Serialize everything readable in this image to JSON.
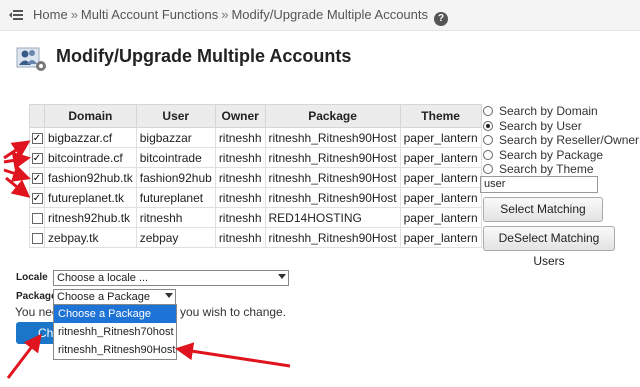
{
  "breadcrumb": {
    "home": "Home",
    "section": "Multi Account Functions",
    "current": "Modify/Upgrade Multiple Accounts",
    "separator": "»"
  },
  "page_title": "Modify/Upgrade Multiple Accounts",
  "table": {
    "headers": [
      "Domain",
      "User",
      "Owner",
      "Package",
      "Theme"
    ],
    "rows": [
      {
        "checked": true,
        "domain": "bigbazzar.cf",
        "user": "bigbazzar",
        "owner": "ritneshh",
        "package": "ritneshh_Ritnesh90Host",
        "theme": "paper_lantern"
      },
      {
        "checked": true,
        "domain": "bitcointrade.cf",
        "user": "bitcointrade",
        "owner": "ritneshh",
        "package": "ritneshh_Ritnesh90Host",
        "theme": "paper_lantern"
      },
      {
        "checked": true,
        "domain": "fashion92hub.tk",
        "user": "fashion92hub",
        "owner": "ritneshh",
        "package": "ritneshh_Ritnesh90Host",
        "theme": "paper_lantern"
      },
      {
        "checked": true,
        "domain": "futureplanet.tk",
        "user": "futureplanet",
        "owner": "ritneshh",
        "package": "ritneshh_Ritnesh90Host",
        "theme": "paper_lantern"
      },
      {
        "checked": false,
        "domain": "ritnesh92hub.tk",
        "user": "ritneshh",
        "owner": "ritneshh",
        "package": "RED14HOSTING",
        "theme": "paper_lantern"
      },
      {
        "checked": false,
        "domain": "zebpay.tk",
        "user": "zebpay",
        "owner": "ritneshh",
        "package": "ritneshh_Ritnesh90Host",
        "theme": "paper_lantern"
      }
    ]
  },
  "search": {
    "options": [
      {
        "label": "Search by Domain",
        "selected": false
      },
      {
        "label": "Search by User",
        "selected": true
      },
      {
        "label": "Search by Reseller/Owner",
        "selected": false
      },
      {
        "label": "Search by Package",
        "selected": false
      },
      {
        "label": "Search by Theme",
        "selected": false
      }
    ],
    "input_value": "user",
    "select_button": "Select Matching Users",
    "deselect_button": "DeSelect Matching Users"
  },
  "form": {
    "locale_label": "Locale",
    "locale_value": "Choose a locale ...",
    "package_label": "Package",
    "package_value": "Choose a Package",
    "package_options": [
      "Choose a Package",
      "ritneshh_Ritnesh70host",
      "ritneshh_Ritnesh90Host"
    ],
    "note_start": "You nee",
    "note_end": "you wish to change.",
    "change_button": "Ch"
  },
  "colors": {
    "accent": "#1a76c8",
    "menu_highlight": "#1e73d6",
    "annotation": "#e0141e"
  }
}
